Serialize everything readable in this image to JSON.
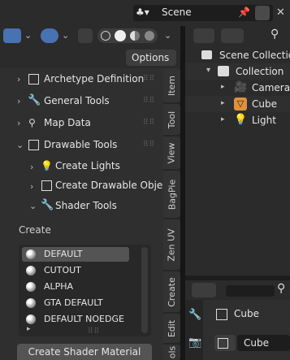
{
  "topbar": {
    "scene_name": "Scene"
  },
  "toolbar": {
    "options_label": "Options"
  },
  "panel": {
    "rows": [
      {
        "label": "Archetype Definition"
      },
      {
        "label": "General Tools"
      },
      {
        "label": "Map Data"
      },
      {
        "label": "Drawable Tools"
      },
      {
        "label": "Create Lights"
      },
      {
        "label": "Create Drawable Objects"
      },
      {
        "label": "Shader Tools"
      }
    ],
    "create_heading": "Create",
    "shaders": [
      "DEFAULT",
      "CUTOUT",
      "ALPHA",
      "GTA DEFAULT",
      "DEFAULT NOEDGE"
    ],
    "create_button": "Create Shader Material"
  },
  "tabs": [
    "Item",
    "Tool",
    "View",
    "BagPie",
    "Zen UV",
    "Create",
    "Edit",
    "ols"
  ],
  "outliner": {
    "scene_collection": "Scene Collection",
    "collection": "Collection",
    "objects": [
      "Camera",
      "Cube",
      "Light"
    ]
  },
  "properties": {
    "object_name": "Cube",
    "data_name": "Cube"
  },
  "colors": {
    "accent": "#4772b3",
    "camera": "#e0913c",
    "mesh": "#e0913c",
    "light": "#e0913c"
  }
}
